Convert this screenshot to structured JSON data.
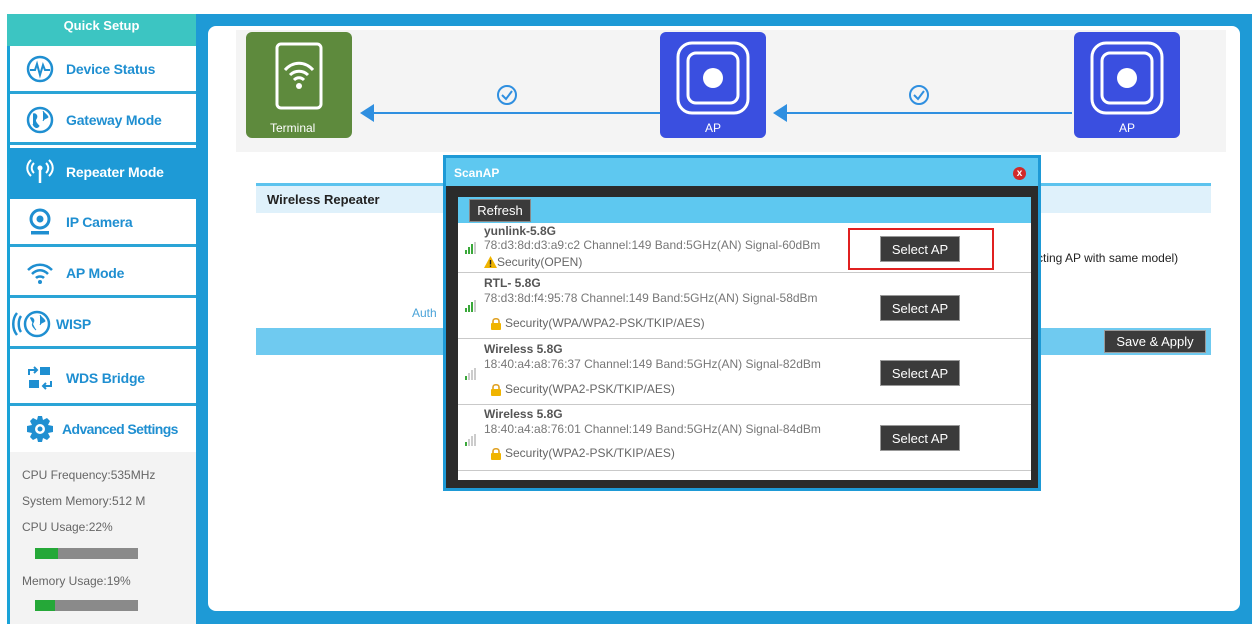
{
  "sidebar": {
    "header": "Quick Setup",
    "items": [
      {
        "label": "Device Status",
        "icon": "pulse-icon"
      },
      {
        "label": "Gateway Mode",
        "icon": "globe-icon"
      },
      {
        "label": "Repeater Mode",
        "icon": "antenna-icon",
        "active": true
      },
      {
        "label": "IP Camera",
        "icon": "camera-icon"
      },
      {
        "label": "AP Mode",
        "icon": "wifi-icon"
      },
      {
        "label": "WISP",
        "icon": "wisp-globe-icon"
      },
      {
        "label": "WDS Bridge",
        "icon": "bridge-icon"
      },
      {
        "label": "Advanced Settings",
        "icon": "gear-icon"
      }
    ],
    "system": {
      "cpu_frequency": "CPU Frequency:535MHz",
      "system_memory": "System Memory:512 M",
      "cpu_usage": "CPU Usage:22%",
      "cpu_usage_value": 0.22,
      "memory_usage": "Memory Usage:19%",
      "memory_usage_value": 0.19
    }
  },
  "topology": {
    "terminal_label": "Terminal",
    "ap1_label": "AP",
    "ap2_label": "AP"
  },
  "main": {
    "section_title": "Wireless Repeater",
    "side_note": "cting AP with same model)",
    "auth_partial": "Auth",
    "save_button": "Save & Apply"
  },
  "modal": {
    "title": "ScanAP",
    "close": "x",
    "refresh_button": "Refresh",
    "select_button": "Select AP",
    "networks": [
      {
        "name": "yunlink-5.8G",
        "details": "78:d3:8d:d3:a9:c2 Channel:149 Band:5GHz(AN) Signal-60dBm",
        "security": "Security(OPEN)",
        "security_icon": "warning-icon",
        "signal_bars": 3
      },
      {
        "name": "RTL- 5.8G",
        "details": "78:d3:8d:f4:95:78 Channel:149 Band:5GHz(AN) Signal-58dBm",
        "security": "Security(WPA/WPA2-PSK/TKIP/AES)",
        "security_icon": "lock-icon",
        "signal_bars": 3
      },
      {
        "name": "Wireless 5.8G",
        "details": "18:40:a4:a8:76:37 Channel:149 Band:5GHz(AN) Signal-82dBm",
        "security": "Security(WPA2-PSK/TKIP/AES)",
        "security_icon": "lock-icon",
        "signal_bars": 1
      },
      {
        "name": "Wireless 5.8G",
        "details": "18:40:a4:a8:76:01 Channel:149 Band:5GHz(AN) Signal-84dBm",
        "security": "Security(WPA2-PSK/TKIP/AES)",
        "security_icon": "lock-icon",
        "signal_bars": 1
      }
    ]
  },
  "colors": {
    "accent": "#1e9ad6",
    "teal_header": "#3cc5c2",
    "terminal_green": "#5e8a3d",
    "ap_blue": "#3a4fe0",
    "highlight_red": "#e02020"
  }
}
